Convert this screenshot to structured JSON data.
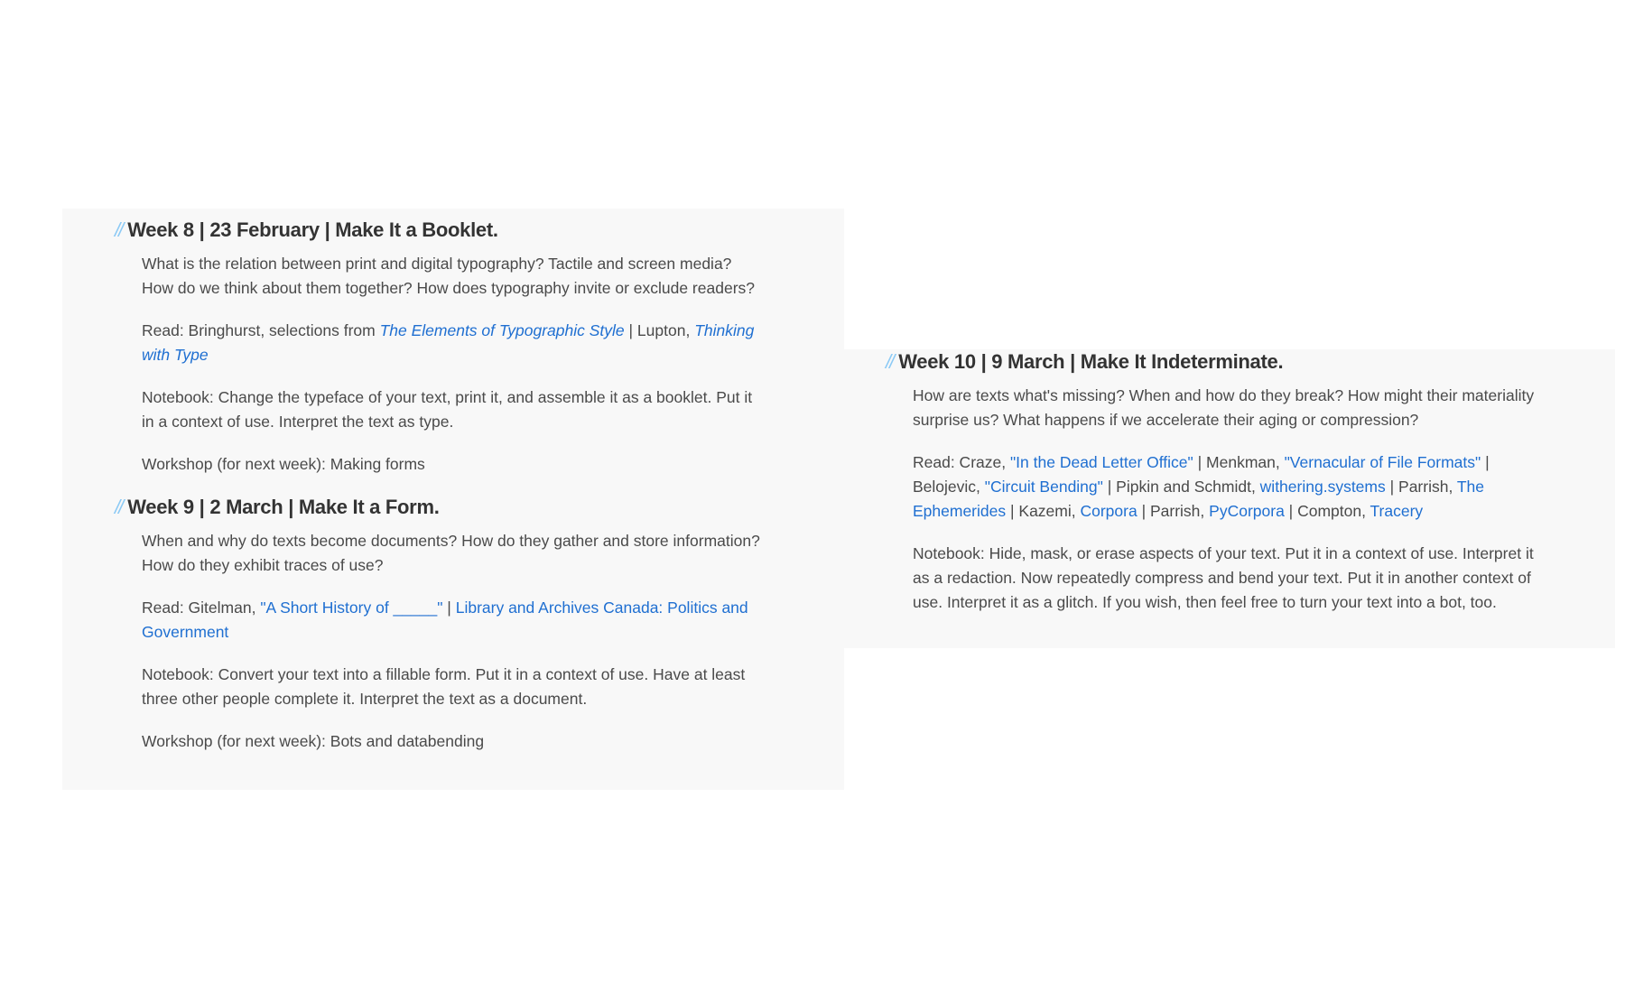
{
  "weeks": [
    {
      "title": "Week 8 | 23 February | Make It a Booklet.",
      "questions": "What is the relation between print and digital typography? Tactile and screen media? How do we think about them together? How does typography invite or exclude readers?",
      "read": {
        "prefix": "Read: Bringhurst, selections from ",
        "link1": "The Elements of Typographic Style",
        "mid": " | Lupton, ",
        "link2": "Thinking with Type"
      },
      "notebook": "Notebook: Change the typeface of your text, print it, and assemble it as a booklet. Put it in a context of use. Interpret the text as type.",
      "workshop": "Workshop (for next week): Making forms"
    },
    {
      "title": "Week 9 | 2 March | Make It a Form.",
      "questions": "When and why do texts become documents? How do they gather and store information? How do they exhibit traces of use?",
      "read": {
        "prefix": "Read: Gitelman, ",
        "link1": "\"A Short History of _____\"",
        "mid": " | ",
        "link2": "Library and Archives Canada: Politics and Government"
      },
      "notebook": "Notebook: Convert your text into a fillable form. Put it in a context of use. Have at least three other people complete it. Interpret the text as a document.",
      "workshop": "Workshop (for next week): Bots and databending"
    },
    {
      "title": "Week 10 | 9 March | Make It Indeterminate.",
      "questions": "How are texts what's missing? When and how do they break? How might their materiality surprise us? What happens if we accelerate their aging or compression?",
      "read": {
        "t0": "Read: Craze, ",
        "l1": "\"In the Dead Letter Office\"",
        "t1": " | Menkman, ",
        "l2": "\"Vernacular of File Formats\"",
        "t2": " | Belojevic, ",
        "l3": "\"Circuit Bending\"",
        "t3": " | Pipkin and Schmidt, ",
        "l4": "withering.systems",
        "t4": " | Parrish, ",
        "l5": "The Ephemerides",
        "t5": " | Kazemi, ",
        "l6": "Corpora",
        "t6": " | Parrish, ",
        "l7": "PyCorpora",
        "t7": " | Compton, ",
        "l8": "Tracery"
      },
      "notebook": "Notebook: Hide, mask, or erase aspects of your text. Put it in a context of use. Interpret it as a redaction. Now repeatedly compress and bend your text. Put it in another context of use. Interpret it as a glitch. If you wish, then feel free to turn your text into a bot, too."
    }
  ],
  "heading_marker": "//",
  "colors": {
    "link": "#1f6fd1",
    "marker": "#8ccaf5",
    "panel": "#f8f8f8",
    "text": "#4a4a4a"
  }
}
